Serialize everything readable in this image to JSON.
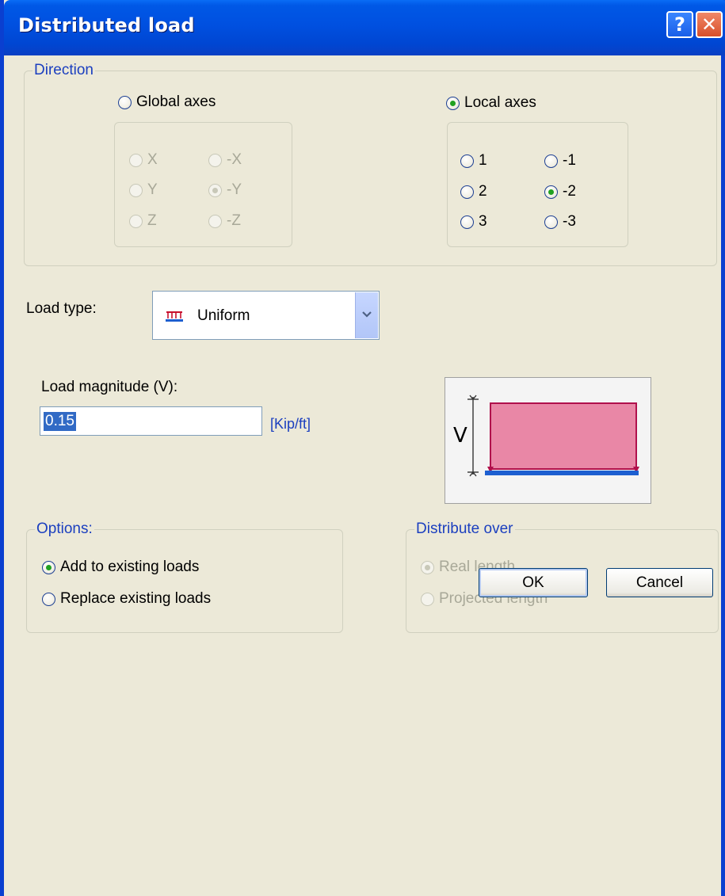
{
  "window": {
    "title": "Distributed load",
    "help_glyph": "?",
    "close_glyph": "✕"
  },
  "direction": {
    "label": "Direction",
    "global": {
      "label": "Global axes",
      "selected": false,
      "options": [
        {
          "label": "X",
          "selected": false
        },
        {
          "label": "-X",
          "selected": false
        },
        {
          "label": "Y",
          "selected": false
        },
        {
          "label": "-Y",
          "selected": true
        },
        {
          "label": "Z",
          "selected": false
        },
        {
          "label": "-Z",
          "selected": false
        }
      ]
    },
    "local": {
      "label": "Local axes",
      "selected": true,
      "options": [
        {
          "label": "1",
          "selected": false
        },
        {
          "label": "-1",
          "selected": false
        },
        {
          "label": "2",
          "selected": false
        },
        {
          "label": "-2",
          "selected": true
        },
        {
          "label": "3",
          "selected": false
        },
        {
          "label": "-3",
          "selected": false
        }
      ]
    }
  },
  "load_type": {
    "label": "Load type:",
    "selected": "Uniform",
    "icon": "uniform-load-icon"
  },
  "magnitude": {
    "label": "Load magnitude (V):",
    "value": "0.15",
    "unit": "[Kip/ft]",
    "diagram_label": "V"
  },
  "options": {
    "label": "Options:",
    "items": [
      {
        "label": "Add to existing loads",
        "selected": true
      },
      {
        "label": "Replace existing loads",
        "selected": false
      }
    ]
  },
  "distribute": {
    "label": "Distribute over",
    "items": [
      {
        "label": "Real length",
        "selected": true
      },
      {
        "label": "Projected length",
        "selected": false
      }
    ]
  },
  "buttons": {
    "ok": "OK",
    "cancel": "Cancel"
  },
  "colors": {
    "title_bar": "#0050e0",
    "accent_label": "#1b3fbf",
    "load_fill": "#e987a6",
    "load_stroke": "#b0104c",
    "beam": "#1d5fd0"
  }
}
